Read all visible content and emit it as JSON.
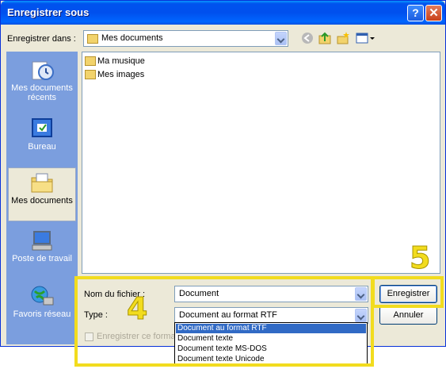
{
  "window": {
    "title": "Enregistrer sous"
  },
  "save_in": {
    "label": "Enregistrer dans :",
    "value": "Mes documents"
  },
  "places": [
    {
      "label": "Mes documents récents"
    },
    {
      "label": "Bureau"
    },
    {
      "label": "Mes documents"
    },
    {
      "label": "Poste de travail"
    },
    {
      "label": "Favoris réseau"
    }
  ],
  "files": [
    {
      "name": "Ma musique"
    },
    {
      "name": "Mes images"
    }
  ],
  "filename": {
    "label": "Nom du fichier :",
    "value": "Document"
  },
  "filetype": {
    "label": "Type :",
    "value": "Document au format RTF",
    "options": [
      "Document au format RTF",
      "Document texte",
      "Document texte MS-DOS",
      "Document texte Unicode"
    ]
  },
  "checkbox": {
    "label": "Enregistrer ce format"
  },
  "buttons": {
    "save": "Enregistrer",
    "cancel": "Annuler"
  },
  "callouts": {
    "a": "4",
    "b": "5"
  },
  "colors": {
    "titlebar": "#0053ee",
    "highlight": "#f2dc1e",
    "selection": "#316ac5"
  }
}
